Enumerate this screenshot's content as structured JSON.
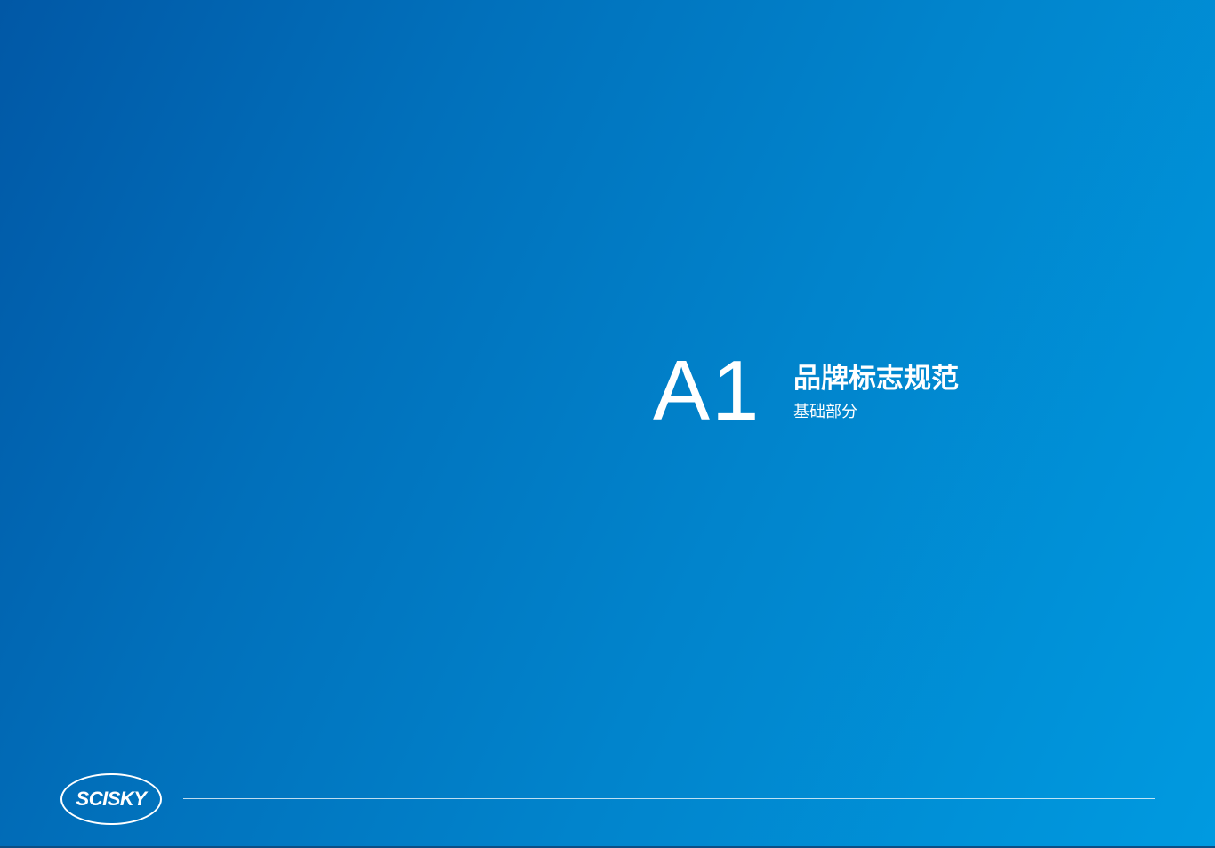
{
  "section": {
    "code": "A1",
    "title": "品牌标志规范",
    "subtitle": "基础部分"
  },
  "brand": {
    "logo_text": "SCISKY"
  },
  "colors": {
    "background_start": "#0158a6",
    "background_end": "#009ae0",
    "text": "#ffffff"
  }
}
